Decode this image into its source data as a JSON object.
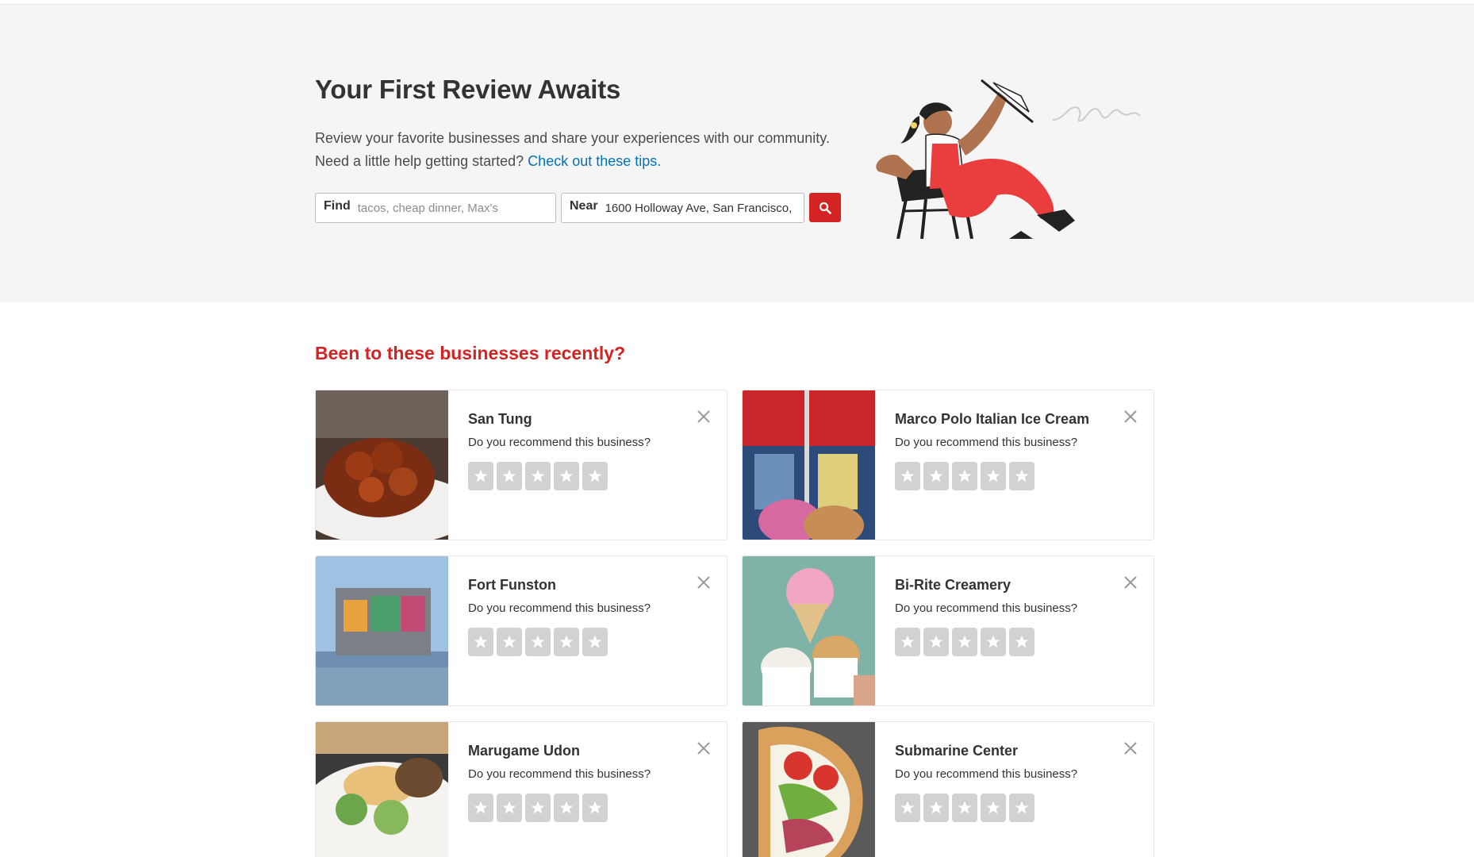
{
  "hero": {
    "title": "Your First Review Awaits",
    "description": "Review your favorite businesses and share your experiences with our community. Need a little help getting started?",
    "tips_link": "Check out these tips.",
    "find_label": "Find",
    "find_placeholder": "tacos, cheap dinner, Max's",
    "near_label": "Near",
    "near_value": "1600 Holloway Ave, San Francisco,",
    "search_icon": "search-icon"
  },
  "recent": {
    "title": "Been to these businesses recently?",
    "question": "Do you recommend this business?",
    "businesses": [
      {
        "name": "San Tung"
      },
      {
        "name": "Marco Polo Italian Ice Cream"
      },
      {
        "name": "Fort Funston"
      },
      {
        "name": "Bi-Rite Creamery"
      },
      {
        "name": "Marugame Udon"
      },
      {
        "name": "Submarine Center"
      }
    ]
  },
  "colors": {
    "brand_red": "#d32323",
    "link_blue": "#0073bb",
    "hero_bg": "#f5f5f5",
    "star_empty": "#d2d2d2"
  }
}
